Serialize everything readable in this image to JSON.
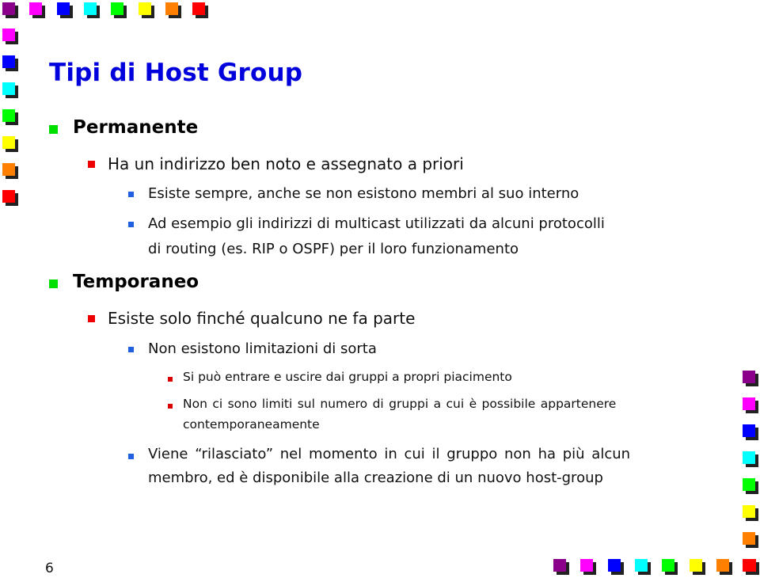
{
  "slide": {
    "title": "Tipi di Host Group",
    "page_number": "6",
    "colors": {
      "title": "#0000dd",
      "bullet_level1": "#00e000",
      "bullet_level2": "#ee0000",
      "bullet_level3": "#1f5fe0",
      "bullet_level4": "#dd0000"
    },
    "decoration_palette": [
      "#8b008b",
      "#ff00ff",
      "#0000ff",
      "#00ffff",
      "#00ff00",
      "#ffff00",
      "#ff8000",
      "#ff0000"
    ],
    "bullets": [
      {
        "level": 1,
        "text": "Permanente"
      },
      {
        "level": 2,
        "text": "Ha un indirizzo ben noto e assegnato a priori"
      },
      {
        "level": 3,
        "text": "Esiste sempre, anche se non esistono membri al suo interno"
      },
      {
        "level": 3,
        "text": "Ad esempio gli indirizzi di multicast utilizzati da alcuni protocolli",
        "continuation": "di routing (es. RIP o OSPF) per il loro funzionamento"
      },
      {
        "level": 1,
        "text": "Temporaneo"
      },
      {
        "level": 2,
        "text": "Esiste solo finché qualcuno ne fa parte"
      },
      {
        "level": 3,
        "text": "Non esistono limitazioni di sorta"
      },
      {
        "level": 4,
        "text": "Si può entrare e uscire dai gruppi a propri piacimento"
      },
      {
        "level": 4,
        "text": "Non ci sono limiti sul numero di gruppi a cui è possibile appartenere",
        "continuation": "contemporaneamente"
      },
      {
        "level": 3,
        "text": "Viene “rilasciato” nel momento in cui il gruppo non ha più alcun",
        "continuation": "membro, ed è disponibile alla creazione di un nuovo host-group"
      }
    ]
  }
}
